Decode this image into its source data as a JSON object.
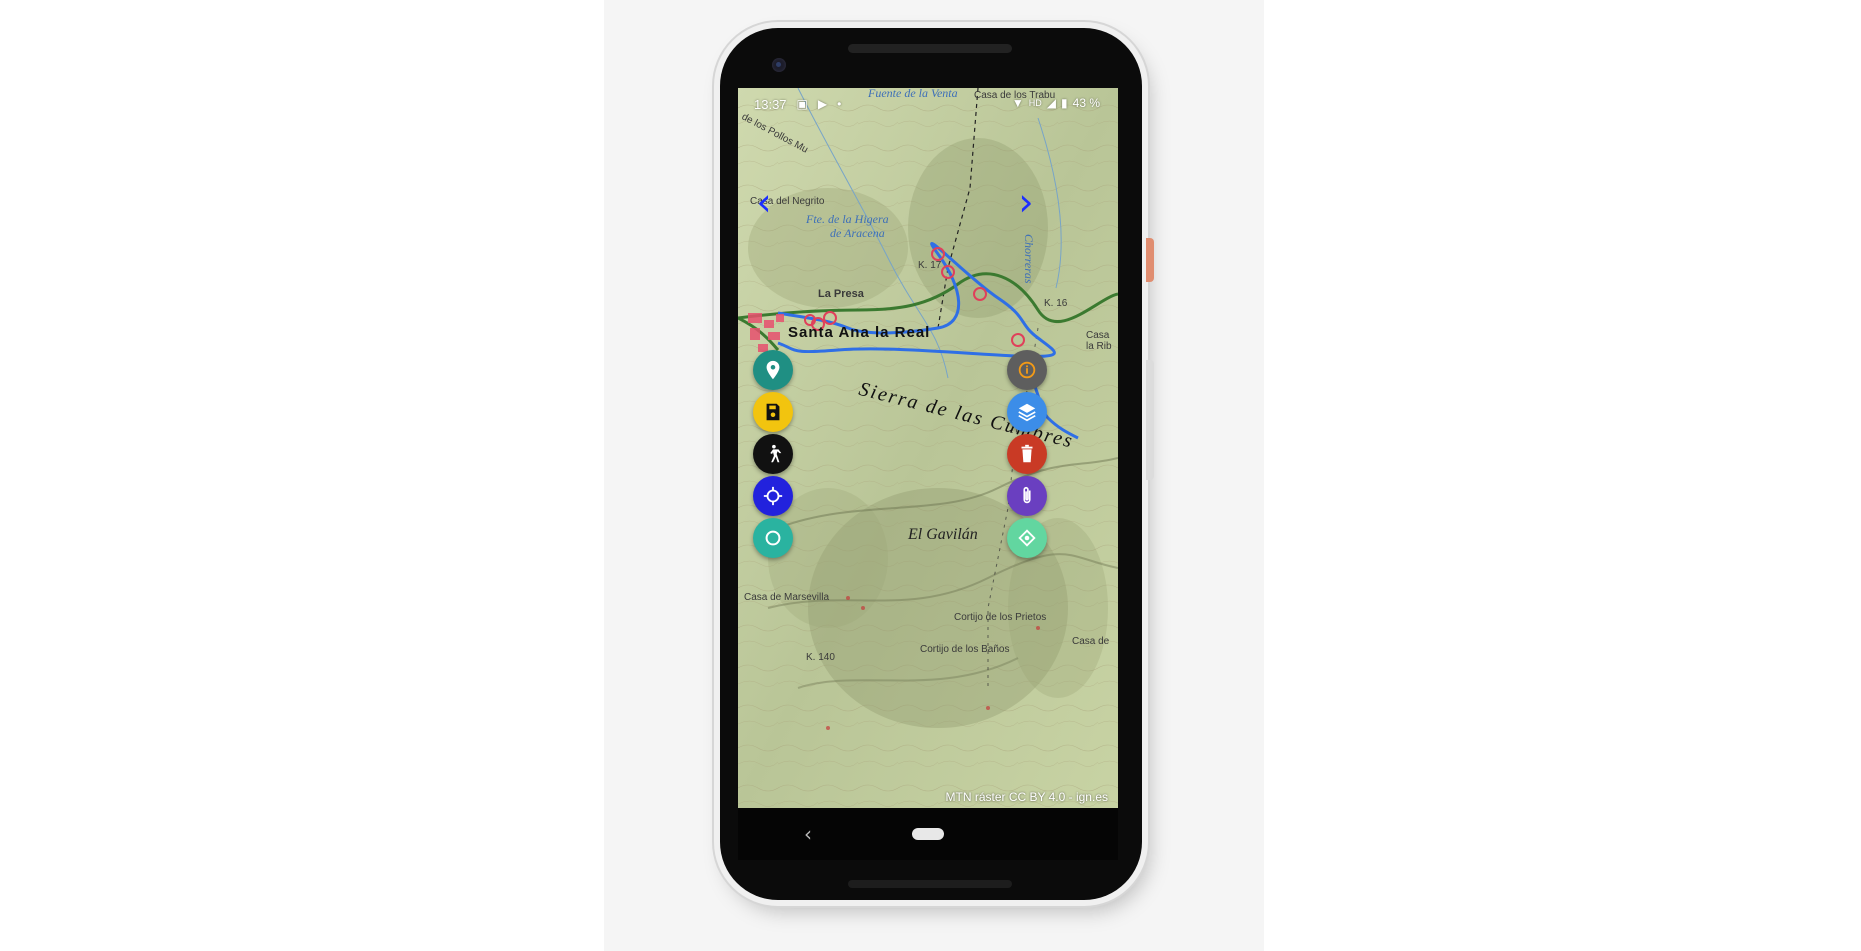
{
  "status_bar": {
    "time": "13:37",
    "notif_icons": [
      "notes-icon",
      "youtube-icon",
      "dot-icon"
    ],
    "right_text": "43 %",
    "right_icons": [
      "wifi-icon",
      "hd-signal-icon",
      "signal-icon",
      "battery-icon"
    ]
  },
  "nav": {
    "prev": "‹",
    "next": "›"
  },
  "map": {
    "labels": {
      "fuente_venta": "Fuente de la Venta",
      "casa_trabu": "Casa de los Trabu",
      "los_pollos": "de los Pollos Mu",
      "casa_negrito": "Casa del Negrito",
      "fte_higuera": "Fte. de la Higera",
      "aracena": "de Aracena",
      "la_presa": "La Presa",
      "santa_ana": "Santa Ana la Real",
      "casa_la_rib": "Casa\nla Rib",
      "sierra": "Sierra de las Cumbres",
      "el_gavilan": "El Gavilán",
      "casa_marsevilla": "Casa de Marsevilla",
      "cortijo_prietos": "Cortijo de los Prietos",
      "cortijo_banos": "Cortijo de los Baños",
      "casa_de": "Casa de",
      "km_17": "K. 17",
      "km_16": "K. 16",
      "km_140": "K. 140",
      "chorreras": "Chorreras"
    },
    "attribution": "MTN ráster CC BY 4.0 - ign.es"
  },
  "left_fabs": [
    {
      "name": "add-marker-button",
      "icon": "location-pin-icon",
      "color": "#1f8f83"
    },
    {
      "name": "save-button",
      "icon": "floppy-disk-icon",
      "color": "#f2c40f"
    },
    {
      "name": "walk-mode-button",
      "icon": "hiker-icon",
      "color": "#111111"
    },
    {
      "name": "locate-button",
      "icon": "crosshair-icon",
      "color": "#2222dd"
    },
    {
      "name": "record-button",
      "icon": "circle-icon",
      "color": "#2ab3a0"
    }
  ],
  "right_fabs": [
    {
      "name": "info-button",
      "icon": "info-icon",
      "color": "#5e5e5e"
    },
    {
      "name": "layers-button",
      "icon": "layers-icon",
      "color": "#3c8de8"
    },
    {
      "name": "delete-button",
      "icon": "trash-icon",
      "color": "#c93a25"
    },
    {
      "name": "attach-button",
      "icon": "paperclip-icon",
      "color": "#6a3fc0"
    },
    {
      "name": "gps-target-button",
      "icon": "target-icon",
      "color": "#62d6a0"
    }
  ],
  "navbar": {
    "back": "‹"
  }
}
